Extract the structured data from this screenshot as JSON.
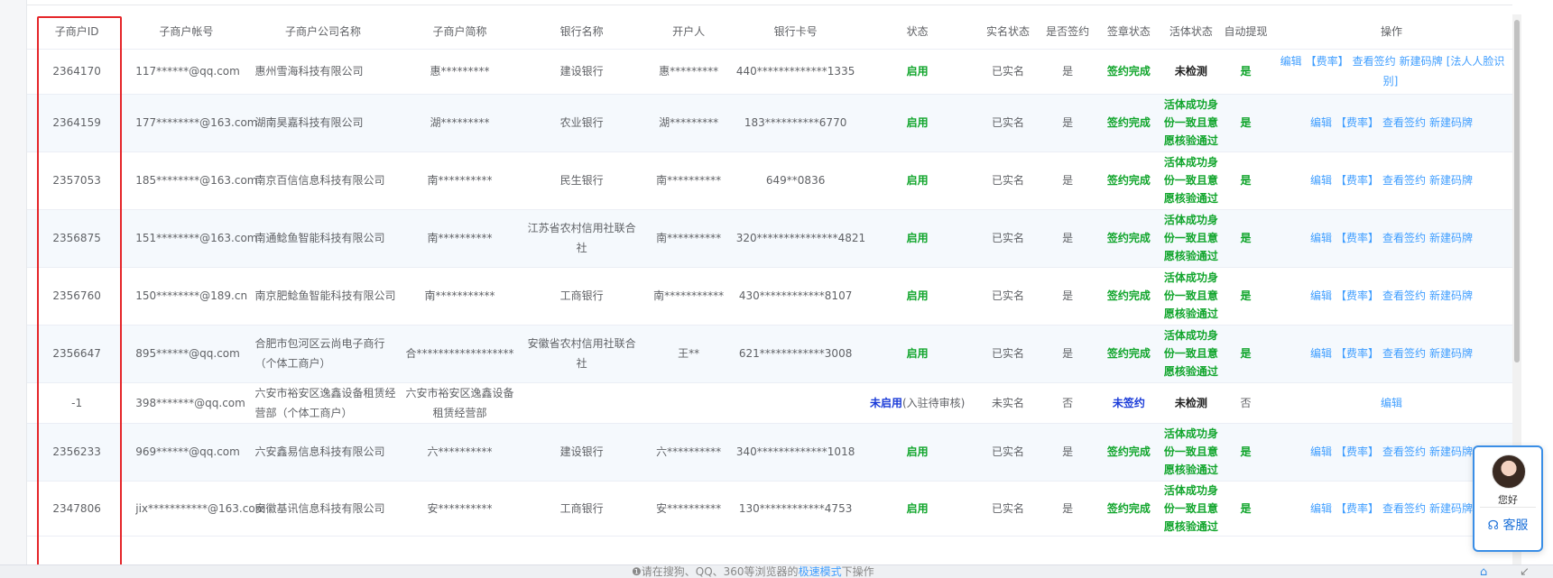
{
  "table": {
    "columns": [
      "子商户ID",
      "子商户帐号",
      "子商户公司名称",
      "子商户简称",
      "银行名称",
      "开户人",
      "银行卡号",
      "状态",
      "实名状态",
      "是否签约",
      "签章状态",
      "活体状态",
      "自动提现",
      "操作"
    ],
    "rows": [
      {
        "id": "2364170",
        "account": "117******@qq.com",
        "company": "惠州雪海科技有限公司",
        "short": "惠*********",
        "bank": "建设银行",
        "holder": "惠*********",
        "card": "440*************1335",
        "status": "启用",
        "status_extra": "",
        "realname": "已实名",
        "signed": "是",
        "sign_status": "签约完成",
        "liveness": "未检测",
        "auto": "是",
        "ops": [
          "编辑",
          "【费率】",
          "查看签约",
          "新建码牌",
          "[法人人脸识别]"
        ]
      },
      {
        "id": "2364159",
        "account": "177********@163.com",
        "company": "湖南昊嘉科技有限公司",
        "short": "湖*********",
        "bank": "农业银行",
        "holder": "湖*********",
        "card": "183**********6770",
        "status": "启用",
        "status_extra": "",
        "realname": "已实名",
        "signed": "是",
        "sign_status": "签约完成",
        "liveness": "活体成功身份一致且意愿核验通过",
        "auto": "是",
        "ops": [
          "编辑",
          "【费率】",
          "查看签约",
          "新建码牌"
        ]
      },
      {
        "id": "2357053",
        "account": "185********@163.com",
        "company": "南京百信信息科技有限公司",
        "short": "南**********",
        "bank": "民生银行",
        "holder": "南**********",
        "card": "649**0836",
        "status": "启用",
        "status_extra": "",
        "realname": "已实名",
        "signed": "是",
        "sign_status": "签约完成",
        "liveness": "活体成功身份一致且意愿核验通过",
        "auto": "是",
        "ops": [
          "编辑",
          "【费率】",
          "查看签约",
          "新建码牌"
        ]
      },
      {
        "id": "2356875",
        "account": "151********@163.com",
        "company": "南通鲶鱼智能科技有限公司",
        "short": "南**********",
        "bank": "江苏省农村信用社联合社",
        "holder": "南**********",
        "card": "320***************4821",
        "status": "启用",
        "status_extra": "",
        "realname": "已实名",
        "signed": "是",
        "sign_status": "签约完成",
        "liveness": "活体成功身份一致且意愿核验通过",
        "auto": "是",
        "ops": [
          "编辑",
          "【费率】",
          "查看签约",
          "新建码牌"
        ]
      },
      {
        "id": "2356760",
        "account": "150********@189.cn",
        "company": "南京肥鲶鱼智能科技有限公司",
        "short": "南***********",
        "bank": "工商银行",
        "holder": "南***********",
        "card": "430************8107",
        "status": "启用",
        "status_extra": "",
        "realname": "已实名",
        "signed": "是",
        "sign_status": "签约完成",
        "liveness": "活体成功身份一致且意愿核验通过",
        "auto": "是",
        "ops": [
          "编辑",
          "【费率】",
          "查看签约",
          "新建码牌"
        ]
      },
      {
        "id": "2356647",
        "account": "895******@qq.com",
        "company": "合肥市包河区云尚电子商行（个体工商户）",
        "short": "合******************",
        "bank": "安徽省农村信用社联合社",
        "holder": "王**",
        "card": "621************3008",
        "status": "启用",
        "status_extra": "",
        "realname": "已实名",
        "signed": "是",
        "sign_status": "签约完成",
        "liveness": "活体成功身份一致且意愿核验通过",
        "auto": "是",
        "ops": [
          "编辑",
          "【费率】",
          "查看签约",
          "新建码牌"
        ]
      },
      {
        "id": "-1",
        "account": "398*******@qq.com",
        "company": "六安市裕安区逸鑫设备租赁经营部（个体工商户）",
        "short": "六安市裕安区逸鑫设备租赁经营部",
        "bank": "",
        "holder": "",
        "card": "",
        "status": "未启用",
        "status_extra": "(入驻待审核)",
        "realname": "未实名",
        "signed": "否",
        "sign_status": "未签约",
        "liveness": "未检测",
        "auto": "否",
        "ops": [
          "编辑"
        ]
      },
      {
        "id": "2356233",
        "account": "969******@qq.com",
        "company": "六安鑫易信息科技有限公司",
        "short": "六**********",
        "bank": "建设银行",
        "holder": "六**********",
        "card": "340*************1018",
        "status": "启用",
        "status_extra": "",
        "realname": "已实名",
        "signed": "是",
        "sign_status": "签约完成",
        "liveness": "活体成功身份一致且意愿核验通过",
        "auto": "是",
        "ops": [
          "编辑",
          "【费率】",
          "查看签约",
          "新建码牌"
        ]
      },
      {
        "id": "2347806",
        "account": "jix***********@163.com",
        "company": "安徽基讯信息科技有限公司",
        "short": "安**********",
        "bank": "工商银行",
        "holder": "安**********",
        "card": "130************4753",
        "status": "启用",
        "status_extra": "",
        "realname": "已实名",
        "signed": "是",
        "sign_status": "签约完成",
        "liveness": "活体成功身份一致且意愿核验通过",
        "auto": "是",
        "ops": [
          "编辑",
          "【费率】",
          "查看签约",
          "新建码牌"
        ]
      }
    ]
  },
  "service": {
    "hello": "您好",
    "label": "客服",
    "avatar_icon": "customer-service-avatar",
    "icon": "headset-icon"
  },
  "footer": {
    "tip_prefix": "请在搜狗、QQ、360等浏览器的",
    "tip_link": "极速模式",
    "tip_suffix": "下操作"
  },
  "colors": {
    "enabled": "#11a52c",
    "unsigned": "#1a3bd8",
    "link": "#409eff",
    "highlight": "#e5262a"
  }
}
